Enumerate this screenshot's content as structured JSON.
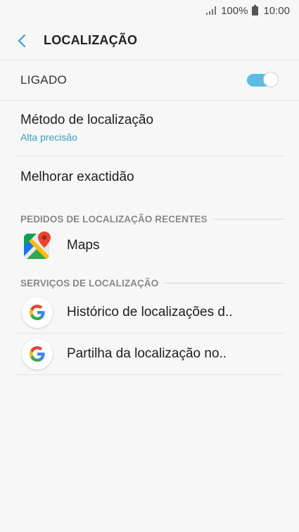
{
  "status_bar": {
    "battery_percent": "100%",
    "time": "10:00"
  },
  "header": {
    "title": "LOCALIZAÇÃO",
    "back_icon": "back-arrow-icon"
  },
  "master_switch": {
    "label": "LIGADO",
    "on": true,
    "accent_color": "#5bbde4"
  },
  "settings": {
    "method": {
      "title": "Método de localização",
      "value": "Alta precisão"
    },
    "accuracy": {
      "title": "Melhorar exactidão"
    }
  },
  "recent_requests": {
    "header": "PEDIDOS DE LOCALIZAÇÃO RECENTES",
    "apps": [
      {
        "name": "Maps",
        "icon": "google-maps-icon"
      }
    ]
  },
  "location_services": {
    "header": "SERVIÇOS DE LOCALIZAÇÃO",
    "items": [
      {
        "name": "Histórico de localizações d..",
        "icon": "google-g-icon"
      },
      {
        "name": "Partilha da localização no..",
        "icon": "google-g-icon"
      }
    ]
  }
}
